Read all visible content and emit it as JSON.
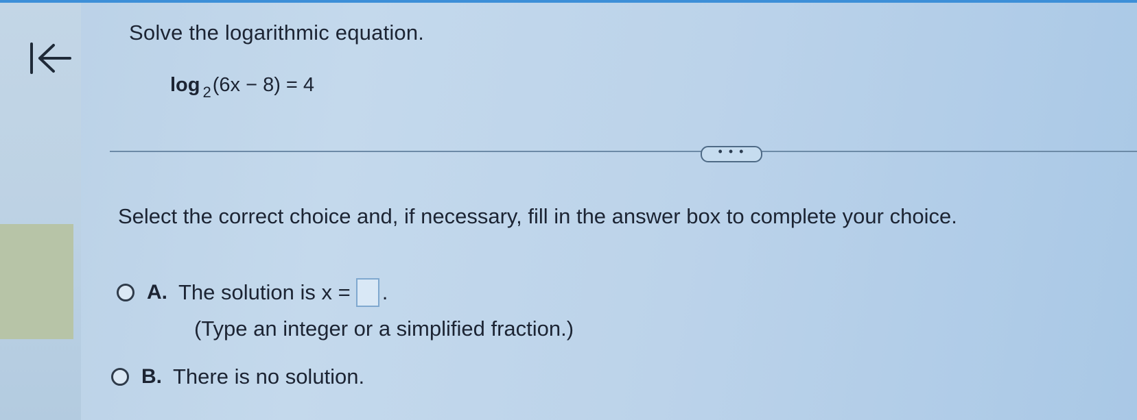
{
  "question": {
    "title": "Solve the logarithmic equation.",
    "equation": {
      "func": "log",
      "base": "2",
      "argument": "(6x − 8) = 4"
    }
  },
  "more_button": {
    "label": "• • •"
  },
  "instruction": "Select the correct choice and, if necessary, fill in the answer box to complete your choice.",
  "choices": [
    {
      "letter": "A.",
      "text_before": "The solution is x =",
      "text_after": ".",
      "answer_value": "",
      "hint": "(Type an integer or a simplified fraction.)"
    },
    {
      "letter": "B.",
      "text": "There is no solution."
    }
  ],
  "icons": {
    "back": "first-page-arrow-icon"
  },
  "colors": {
    "accent": "#3d8fd8",
    "side_tab": "#b7c4a7"
  }
}
